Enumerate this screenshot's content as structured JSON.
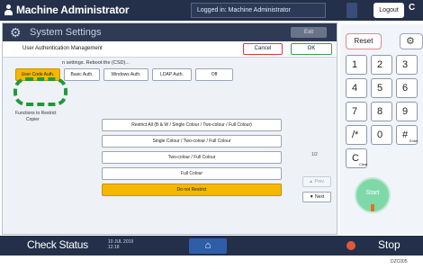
{
  "topbar": {
    "role": "Machine Administrator",
    "login_name": "Logged in: Machine Administrator",
    "logout": "Logout",
    "more": "C"
  },
  "panel": {
    "title": "System Settings",
    "exit": "Exit",
    "subtitle": "User Authentication Management",
    "cancel": "Cancel",
    "ok": "OK",
    "section_label": "n settings. Reboot the (CSD)...",
    "auth_options": [
      {
        "label": "User Code Auth.",
        "selected": true
      },
      {
        "label": "Basic Auth.",
        "selected": false
      },
      {
        "label": "Windows Auth.",
        "selected": false
      },
      {
        "label": "LDAP Auth.",
        "selected": false
      },
      {
        "label": "Off",
        "selected": false
      }
    ],
    "list_label_1": "Functions to Restrict",
    "list_label_2": "Copier",
    "options": [
      {
        "label": "Restrict All (B & W / Single Colour / Two-colour / Full Colour)",
        "selected": false
      },
      {
        "label": "Single Colour / Two-colour / Full Colour",
        "selected": false
      },
      {
        "label": "Two-colour / Full Colour",
        "selected": false
      },
      {
        "label": "Full Colour",
        "selected": false
      },
      {
        "label": "Do not Restrict",
        "selected": true
      }
    ],
    "page": "1/2",
    "prev": "▲ Prev.",
    "next": "▼ Next"
  },
  "keypad": {
    "reset": "Reset",
    "settings_icon": "gear-icon",
    "keys": [
      {
        "main": "1",
        "sub": ""
      },
      {
        "main": "2",
        "sub": ""
      },
      {
        "main": "3",
        "sub": ""
      },
      {
        "main": "4",
        "sub": ""
      },
      {
        "main": "5",
        "sub": ""
      },
      {
        "main": "6",
        "sub": ""
      },
      {
        "main": "7",
        "sub": ""
      },
      {
        "main": "8",
        "sub": ""
      },
      {
        "main": "9",
        "sub": ""
      },
      {
        "main": "/*",
        "sub": ""
      },
      {
        "main": "0",
        "sub": ""
      },
      {
        "main": "#",
        "sub": "Enter"
      },
      {
        "main": "C",
        "sub": "Clear"
      }
    ],
    "start": "Start"
  },
  "bottombar": {
    "check_status": "Check Status",
    "date": "10 JUL 2019",
    "time": "12:18",
    "home_icon": "home-icon",
    "stop": "Stop"
  },
  "figure_id": "DZC005"
}
